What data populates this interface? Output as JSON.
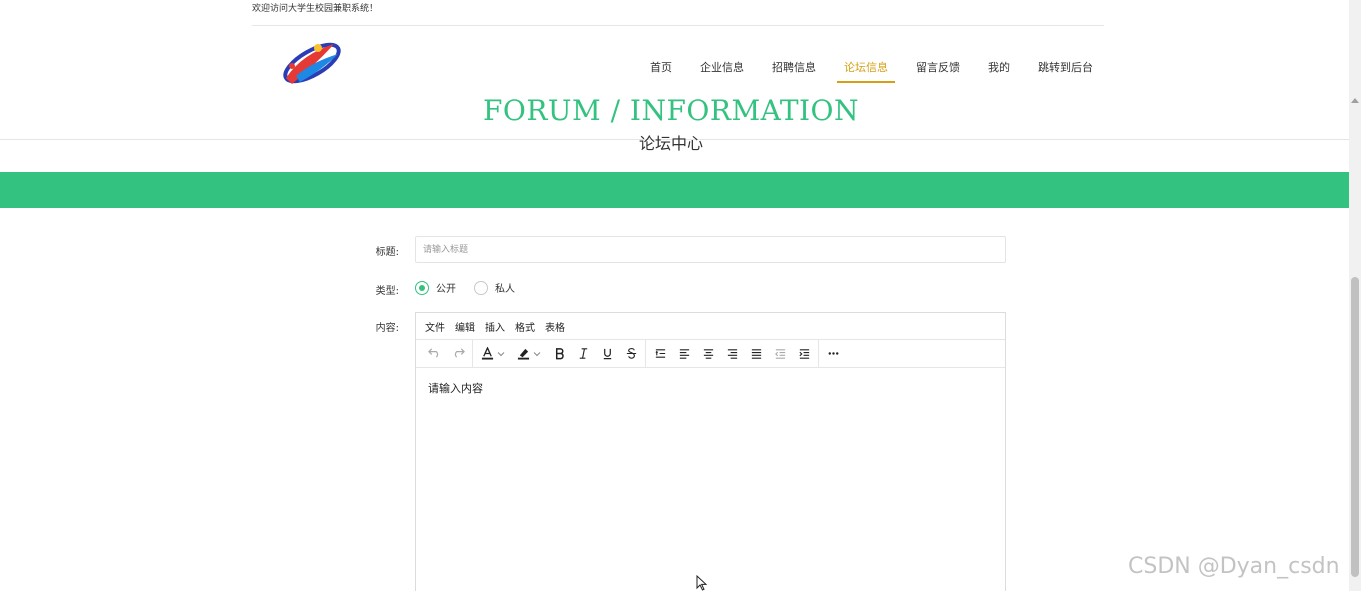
{
  "topbar": {
    "welcome": "欢迎访问大学生校园兼职系统！"
  },
  "nav": {
    "items": [
      {
        "label": "首页",
        "active": false
      },
      {
        "label": "企业信息",
        "active": false
      },
      {
        "label": "招聘信息",
        "active": false
      },
      {
        "label": "论坛信息",
        "active": true
      },
      {
        "label": "留言反馈",
        "active": false
      },
      {
        "label": "我的",
        "active": false
      },
      {
        "label": "跳转到后台",
        "active": false
      }
    ]
  },
  "section": {
    "title_en": "FORUM / INFORMATION",
    "title_cn": "论坛中心"
  },
  "form": {
    "title_label": "标题:",
    "title_placeholder": "请输入标题",
    "type_label": "类型:",
    "type_options": [
      {
        "label": "公开",
        "checked": true
      },
      {
        "label": "私人",
        "checked": false
      }
    ],
    "content_label": "内容:"
  },
  "editor": {
    "menus": [
      "文件",
      "编辑",
      "插入",
      "格式",
      "表格"
    ],
    "placeholder": "请输入内容"
  },
  "watermark": "CSDN @Dyan_csdn",
  "colors": {
    "accent_green": "#33c27f",
    "nav_active": "#d4a017"
  }
}
